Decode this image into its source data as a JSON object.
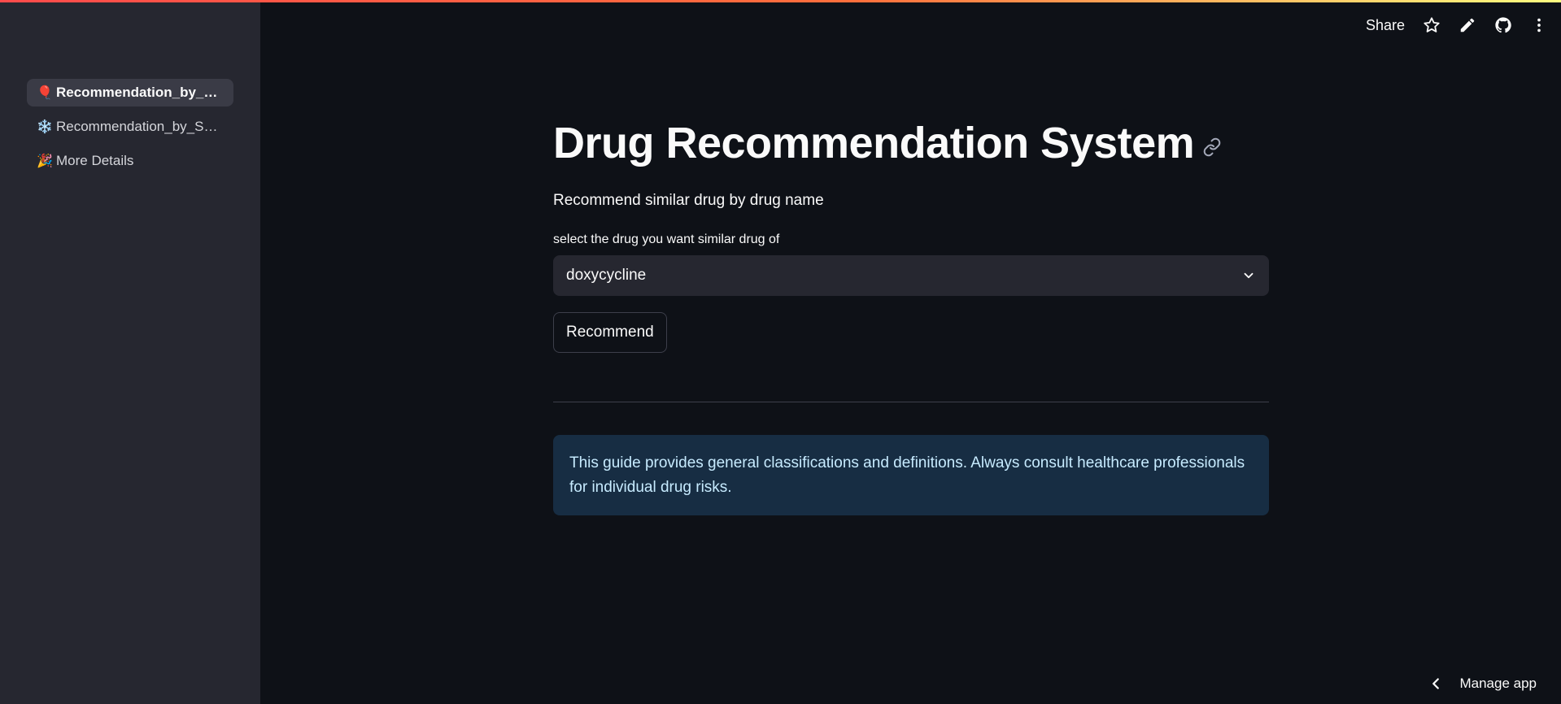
{
  "sidebar": {
    "items": [
      {
        "emoji": "🎈",
        "label": "Recommendation_by_Dr…",
        "active": true
      },
      {
        "emoji": "❄️",
        "label": "Recommendation_by_Sy…",
        "active": false
      },
      {
        "emoji": "🎉",
        "label": "More Details",
        "active": false
      }
    ]
  },
  "header": {
    "share_label": "Share",
    "icons": [
      "star-icon",
      "pencil-icon",
      "github-icon",
      "more-vertical-icon"
    ]
  },
  "main": {
    "title": "Drug Recommendation System",
    "subtitle": "Recommend similar drug by drug name",
    "select_label": "select the drug you want similar drug of",
    "select_value": "doxycycline",
    "button_label": "Recommend",
    "info_text": "This guide provides general classifications and definitions. Always consult healthcare professionals for individual drug risks."
  },
  "footer": {
    "manage_label": "Manage app"
  },
  "colors": {
    "background": "#0e1117",
    "sidebar": "#262730",
    "info_bg": "#172d43",
    "info_text": "#c7ebff"
  }
}
